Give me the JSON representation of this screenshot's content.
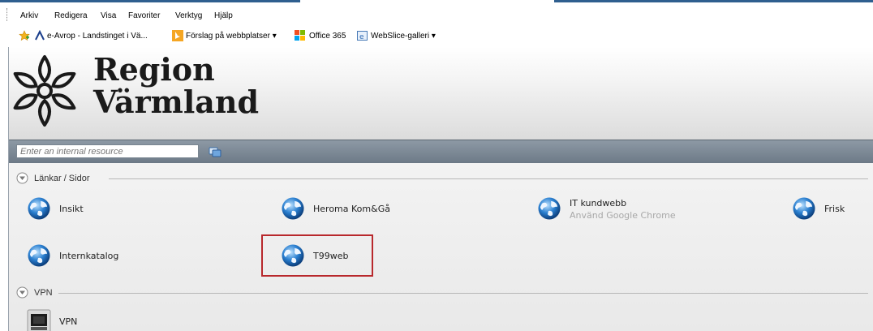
{
  "menubar": {
    "items": [
      "Arkiv",
      "Redigera",
      "Visa",
      "Favoriter",
      "Verktyg",
      "Hjälp"
    ]
  },
  "favorites": [
    {
      "label": "e-Avrop - Landstinget i Vä...",
      "icon": "avrop-icon"
    },
    {
      "label": "Förslag på webbplatser ▾",
      "icon": "bing-icon"
    },
    {
      "label": "Office 365",
      "icon": "office-icon"
    },
    {
      "label": "WebSlice-galleri ▾",
      "icon": "webslice-icon"
    }
  ],
  "header": {
    "logo_line1": "Region",
    "logo_line2": "Värmland"
  },
  "search": {
    "placeholder": "Enter an internal resource"
  },
  "sections": [
    {
      "title": "Länkar / Sidor",
      "links": [
        {
          "name": "Insikt",
          "subtitle": ""
        },
        {
          "name": "Heroma Kom&Gå",
          "subtitle": ""
        },
        {
          "name": "IT kundwebb",
          "subtitle": "Använd Google Chrome"
        },
        {
          "name": "Frisk",
          "subtitle": ""
        },
        {
          "name": "Internkatalog",
          "subtitle": ""
        },
        {
          "name": "T99web",
          "subtitle": ""
        }
      ]
    },
    {
      "title": "VPN",
      "links": [
        {
          "name": "VPN",
          "subtitle": ""
        }
      ]
    }
  ],
  "colors": {
    "highlight": "#b8282c",
    "searchbar": "#7a8691",
    "globe": "#2a7fd0"
  }
}
